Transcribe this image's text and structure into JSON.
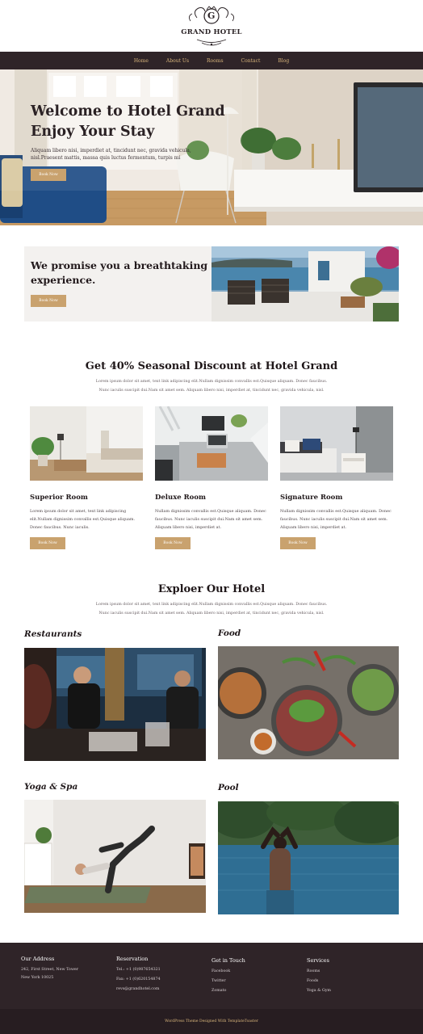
{
  "brand": {
    "name": "GRAND HOTEL",
    "initial": "G"
  },
  "nav": [
    {
      "label": "Home"
    },
    {
      "label": "About Us"
    },
    {
      "label": "Rooms"
    },
    {
      "label": "Contact"
    },
    {
      "label": "Blog"
    }
  ],
  "hero": {
    "title_line1": "Welcome to Hotel Grand",
    "title_line2": "Enjoy Your Stay",
    "text": "Aliquam libero nisi, imperdiet at, tincidunt nec, gravida vehicula, nisl.Praesent mattis, massa quis luctus fermentum, turpis mi",
    "button": "Book Now"
  },
  "promise": {
    "title": "We promise you a breathtaking experience.",
    "button": "Book Now"
  },
  "discount": {
    "title": "Get 40% Seasonal Discount at Hotel Grand",
    "text": "Lorem ipsum dolor sit amet, text link adipiscing elit.Nullam dignissim convallis est.Quisque aliquam. Donec faucibus. Nunc iaculis suscipit dui.Nam sit amet sem. Aliquam libero nisi, imperdiet at, tincidunt nec, gravida vehicula, nisl."
  },
  "rooms": [
    {
      "name": "Superior Room",
      "desc": "Lorem ipsum dolor sit amet, text link adipiscing elit.Nullam dignissim convallis est.Quisque aliquam. Donec faucibus. Nunc iaculis.",
      "button": "Book Now"
    },
    {
      "name": "Deluxe Room",
      "desc": "Nullam dignissim convallis est.Quisque aliquam. Donec faucibus. Nunc iaculis suscipit dui.Nam sit amet sem. Aliquam libero nisi, imperdiet at.",
      "button": "Book Now"
    },
    {
      "name": "Signature Room",
      "desc": "Nullam dignissim convallis est.Quisque aliquam. Donec faucibus. Nunc iaculis suscipit dui.Nam sit amet sem. Aliquam libero nisi, imperdiet at.",
      "button": "Book Now"
    }
  ],
  "explore": {
    "title": "Exploer Our Hotel",
    "text": "Lorem ipsum dolor sit amet, text link adipiscing elit.Nullam dignissim convallis est.Quisque aliquam. Donec faucibus. Nunc iaculis suscipit dui.Nam sit amet sem. Aliquam libero nisi, imperdiet at, tincidunt nec, gravida vehicula, nisl.",
    "items": [
      {
        "label": "Restaurants"
      },
      {
        "label": "Food"
      },
      {
        "label": "Yoga & Spa"
      },
      {
        "label": "Pool"
      }
    ]
  },
  "footer": {
    "address": {
      "heading": "Our Address",
      "line1": "242, First Street, New Tower",
      "line2": "New York 10025"
    },
    "reservation": {
      "heading": "Reservation",
      "tel": "Tel.: +1 (0)987654321",
      "fax": "Fax: +1 (0)620154874",
      "email": "revs@grandhotel.com"
    },
    "touch": {
      "heading": "Get in Touch",
      "links": [
        "Facebook",
        "Twitter",
        "Zomato"
      ]
    },
    "services": {
      "heading": "Services",
      "links": [
        "Rooms",
        "Foods",
        "Yoga & Gym"
      ]
    },
    "copyright": "WordPress Theme Designed With TemplateToaster"
  },
  "colors": {
    "accent": "#c9a26e",
    "nav_bg": "#2f2428",
    "nav_text": "#d9b67c"
  }
}
